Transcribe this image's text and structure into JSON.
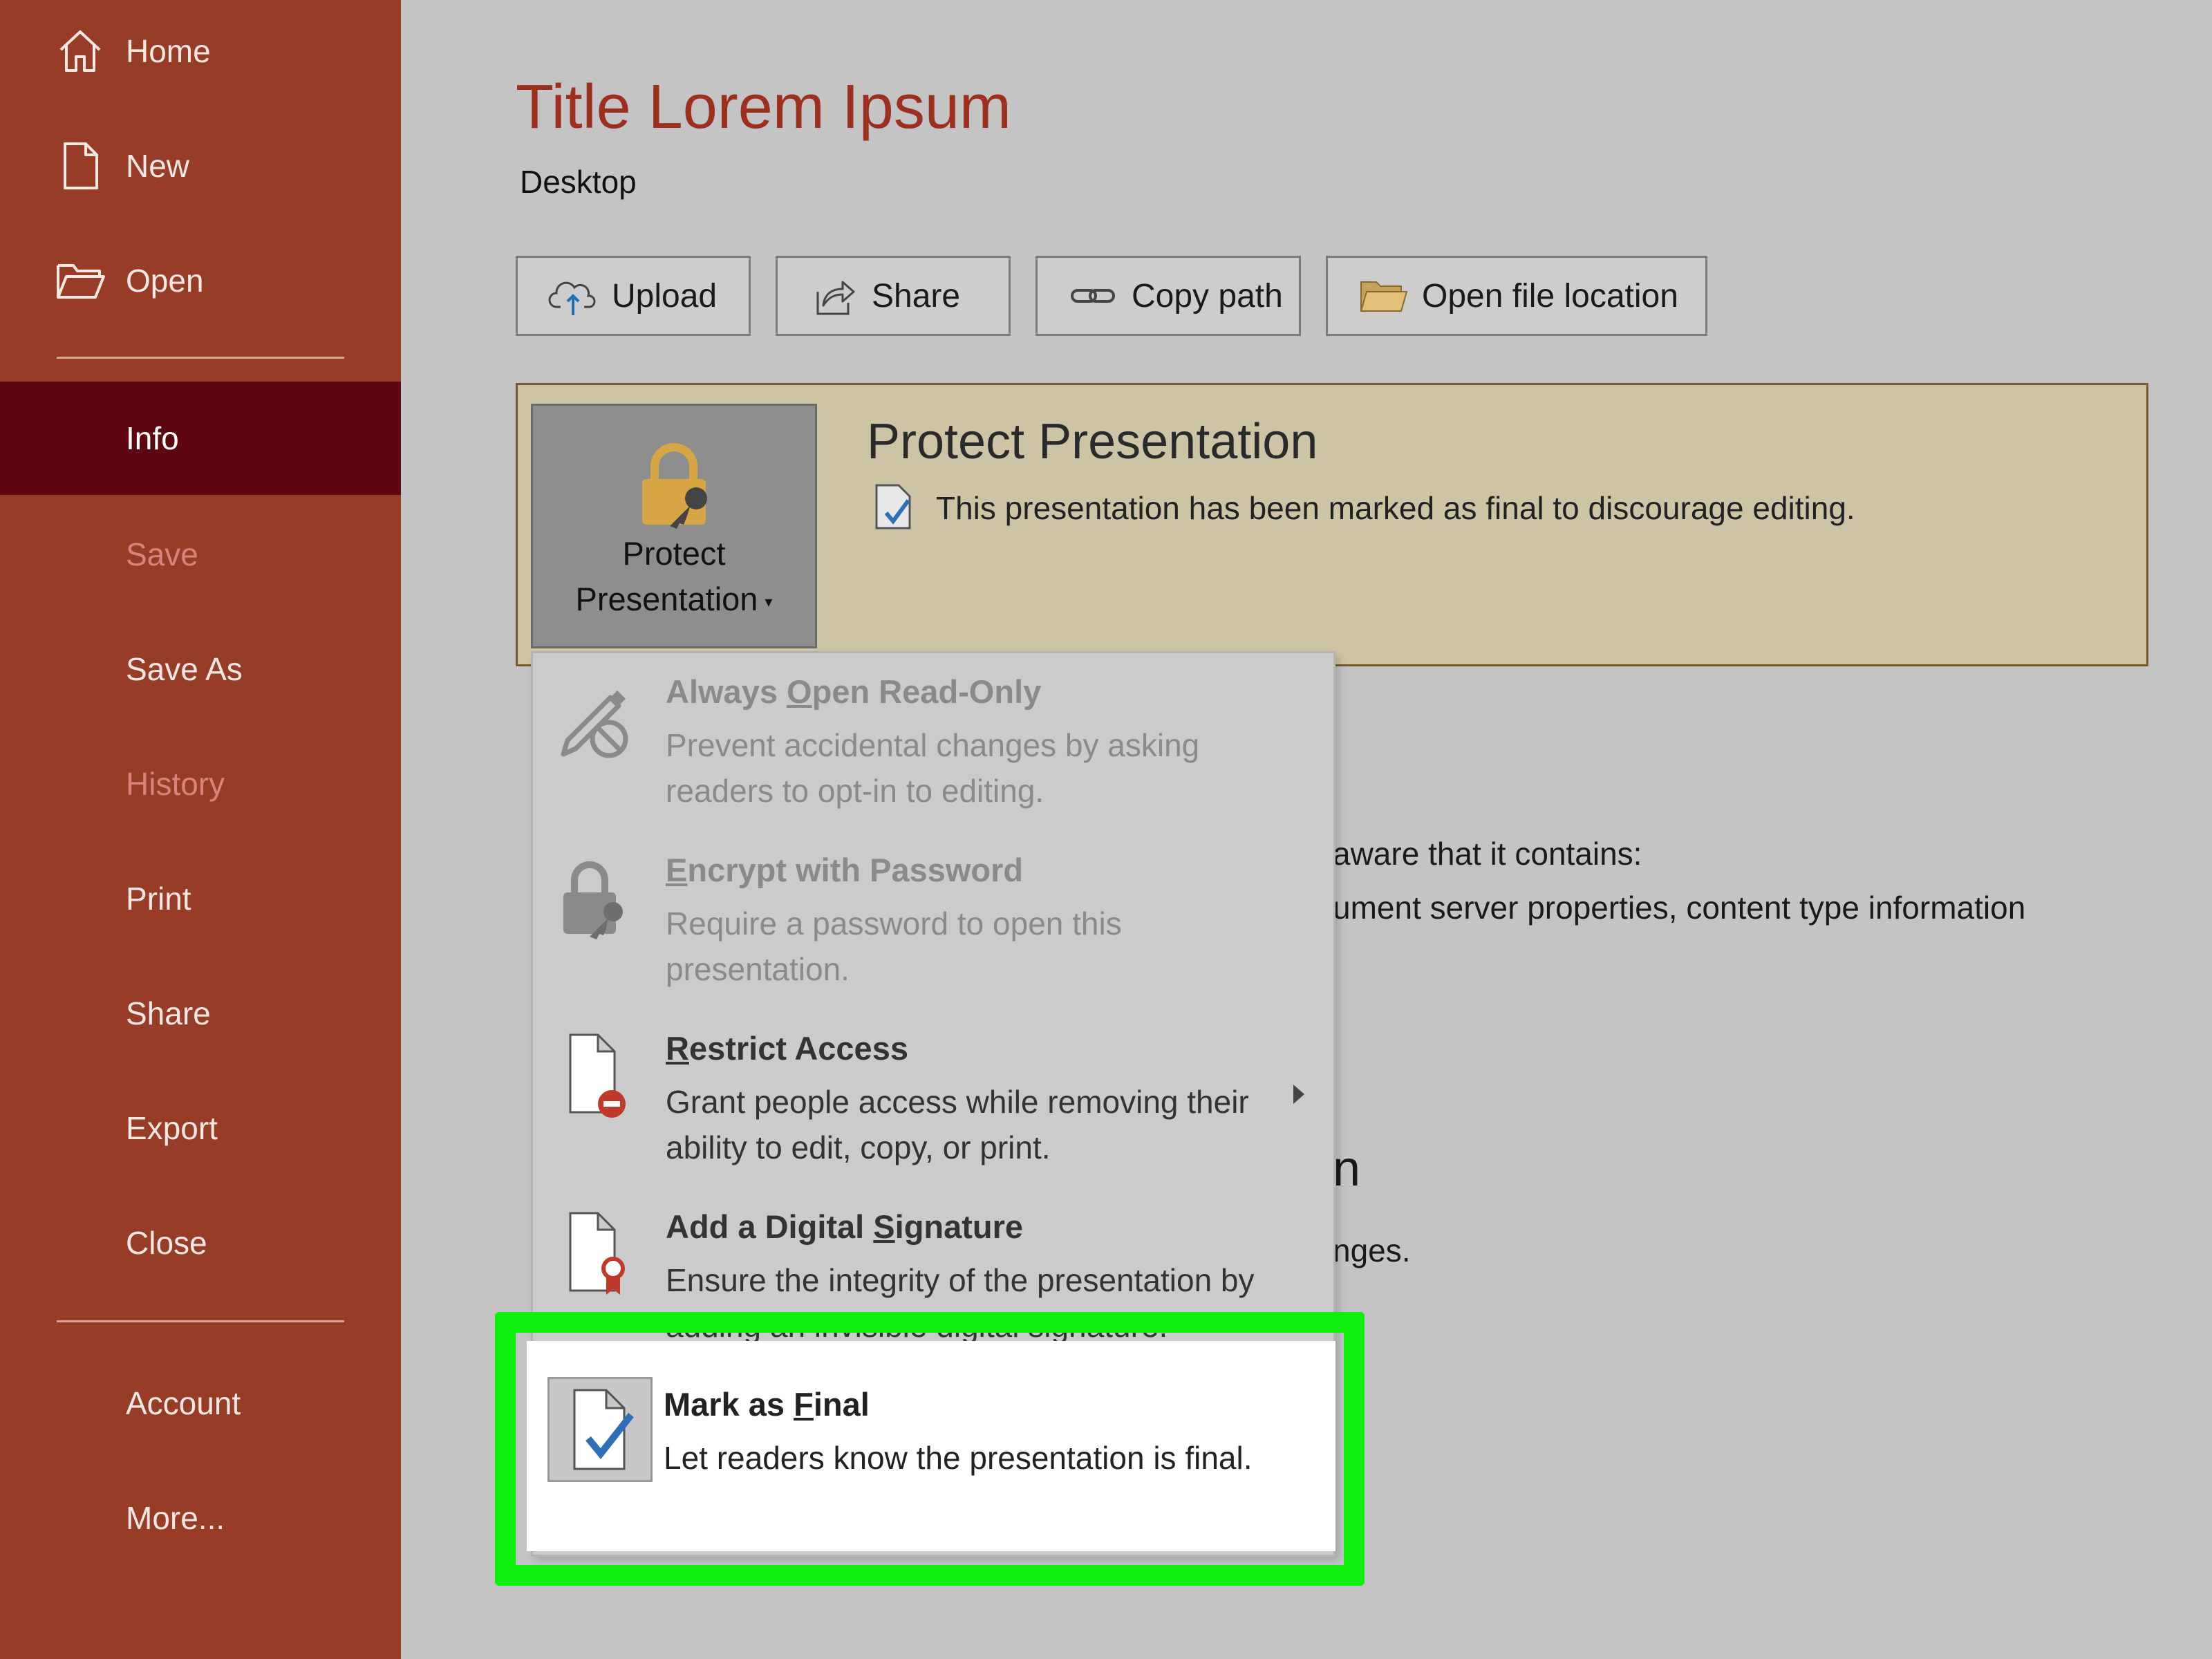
{
  "sidebar": {
    "items": [
      {
        "label": "Home",
        "icon": "home-icon"
      },
      {
        "label": "New",
        "icon": "new-document-icon"
      },
      {
        "label": "Open",
        "icon": "open-folder-icon"
      },
      {
        "label": "Info",
        "selected": true
      },
      {
        "label": "Save",
        "disabled": true
      },
      {
        "label": "Save As"
      },
      {
        "label": "History",
        "disabled": true
      },
      {
        "label": "Print"
      },
      {
        "label": "Share"
      },
      {
        "label": "Export"
      },
      {
        "label": "Close"
      },
      {
        "label": "Account"
      },
      {
        "label": "More..."
      }
    ]
  },
  "document": {
    "title": "Title Lorem Ipsum",
    "location": "Desktop"
  },
  "actions": [
    {
      "label": "Upload",
      "icon": "upload-cloud-icon"
    },
    {
      "label": "Share",
      "icon": "share-icon"
    },
    {
      "label": "Copy path",
      "icon": "link-icon"
    },
    {
      "label": "Open file location",
      "icon": "folder-icon"
    }
  ],
  "protect": {
    "button_line1": "Protect",
    "button_line2": "Presentation",
    "heading": "Protect Presentation",
    "status": "This presentation has been marked as final to discourage editing."
  },
  "background_text": {
    "line1": "aware that it contains:",
    "line2": "ument server properties, content type information",
    "line3": "n",
    "line4": "nges."
  },
  "menu": {
    "items": [
      {
        "title_pre": "Always ",
        "title_key": "O",
        "title_post": "pen Read-Only",
        "desc": "Prevent accidental changes by asking readers to opt-in to editing.",
        "disabled": true,
        "icon": "pencil-no-icon"
      },
      {
        "title_pre": "",
        "title_key": "E",
        "title_post": "ncrypt with Password",
        "desc": "Require a password to open this presentation.",
        "disabled": true,
        "icon": "lock-key-icon"
      },
      {
        "title_pre": "",
        "title_key": "R",
        "title_post": "estrict Access",
        "desc": "Grant people access while removing their ability to edit, copy, or print.",
        "disabled": false,
        "icon": "document-restrict-icon"
      },
      {
        "title_pre": "Add a Digital ",
        "title_key": "S",
        "title_post": "ignature",
        "desc": "Ensure the integrity of the presentation by adding an invisible digital signature.",
        "disabled": false,
        "icon": "document-ribbon-icon"
      },
      {
        "title_pre": "Mark as ",
        "title_key": "F",
        "title_post": "inal",
        "desc": "Let readers know the presentation is final.",
        "disabled": false,
        "icon": "document-check-icon"
      }
    ]
  },
  "colors": {
    "sidebar": "#973c27",
    "sidebar_selected": "#5e0711",
    "highlight": "#0ef00c",
    "title": "#9d2f1f",
    "protect_panel": "#cdc4a6"
  }
}
